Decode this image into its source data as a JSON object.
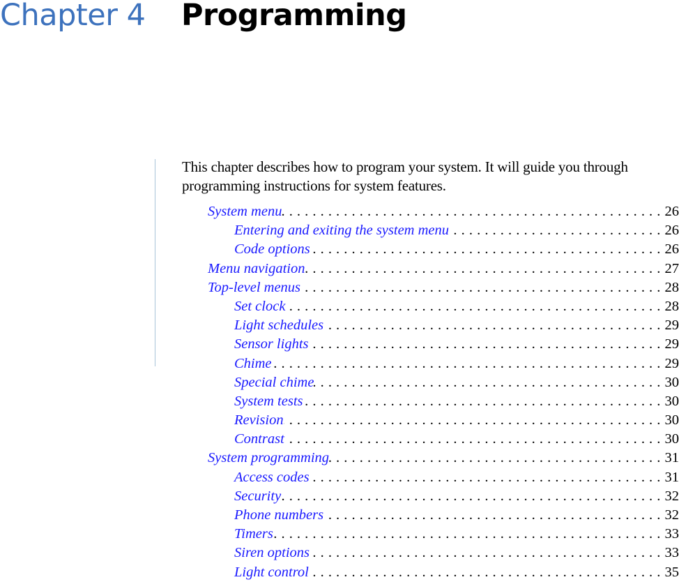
{
  "header": {
    "chapter_label": "Chapter 4",
    "chapter_title": "Programming",
    "chapter_color": "#3d72bd"
  },
  "intro": "This chapter describes how to program your system. It will guide you through programming instructions for system features.",
  "toc": [
    {
      "level": 1,
      "label": "System menu",
      "page": "26"
    },
    {
      "level": 2,
      "label": "Entering and exiting the system menu",
      "page": "26"
    },
    {
      "level": 2,
      "label": "Code options",
      "page": "26"
    },
    {
      "level": 1,
      "label": "Menu navigation",
      "page": "27"
    },
    {
      "level": 1,
      "label": "Top-level menus",
      "page": "28"
    },
    {
      "level": 2,
      "label": "Set clock",
      "page": "28"
    },
    {
      "level": 2,
      "label": "Light schedules",
      "page": "29"
    },
    {
      "level": 2,
      "label": "Sensor lights",
      "page": "29"
    },
    {
      "level": 2,
      "label": "Chime",
      "page": "29"
    },
    {
      "level": 2,
      "label": "Special chime",
      "page": "30"
    },
    {
      "level": 2,
      "label": "System tests",
      "page": "30"
    },
    {
      "level": 2,
      "label": "Revision",
      "page": "30"
    },
    {
      "level": 2,
      "label": "Contrast",
      "page": "30"
    },
    {
      "level": 1,
      "label": "System programming",
      "page": "31"
    },
    {
      "level": 2,
      "label": "Access codes",
      "page": "31"
    },
    {
      "level": 2,
      "label": "Security",
      "page": "32"
    },
    {
      "level": 2,
      "label": "Phone numbers",
      "page": "32"
    },
    {
      "level": 2,
      "label": "Timers",
      "page": "33"
    },
    {
      "level": 2,
      "label": "Siren options",
      "page": "33"
    },
    {
      "level": 2,
      "label": "Light control",
      "page": "35"
    }
  ]
}
